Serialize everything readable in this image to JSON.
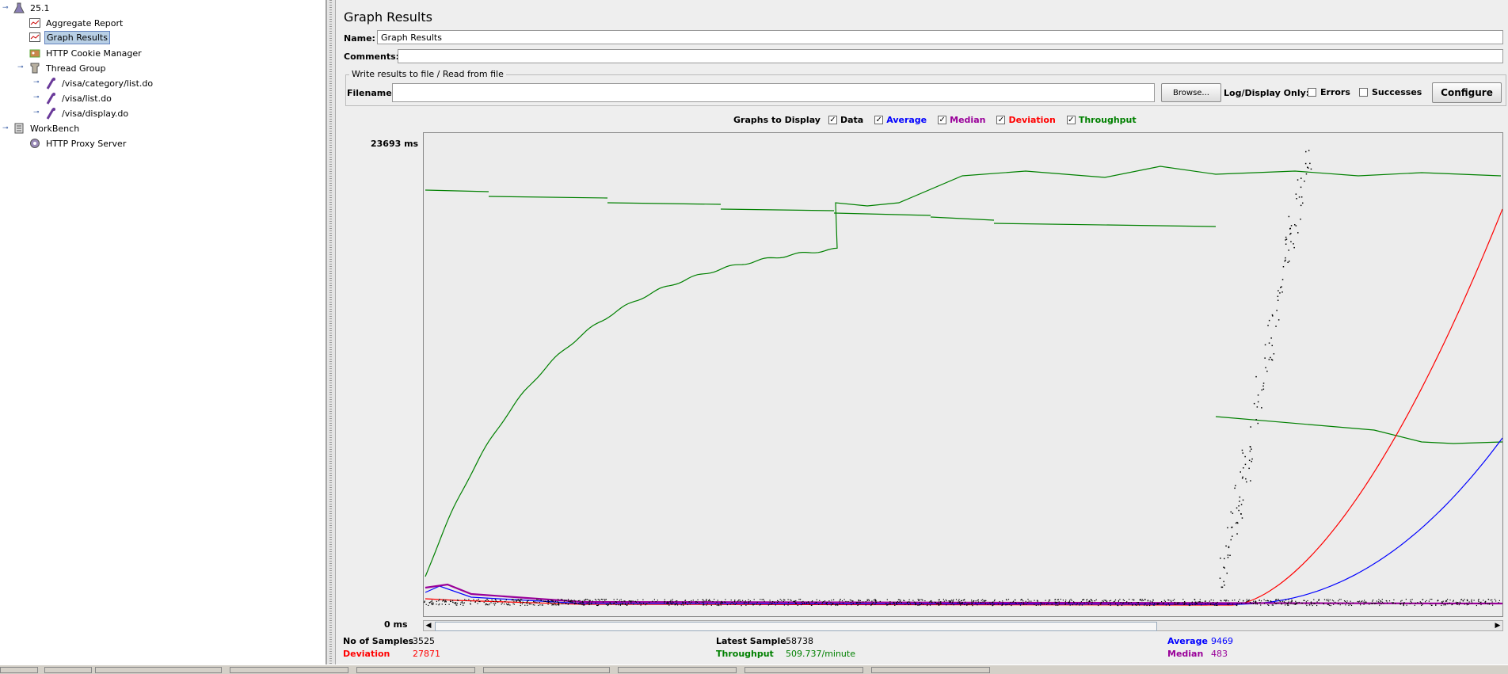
{
  "tree": {
    "items": [
      {
        "label": "25.1",
        "icon": "test-plan-icon"
      },
      {
        "label": "Aggregate Report",
        "icon": "report-icon"
      },
      {
        "label": "Graph Results",
        "icon": "graph-icon"
      },
      {
        "label": "HTTP Cookie Manager",
        "icon": "cookie-manager-icon"
      },
      {
        "label": "Thread Group",
        "icon": "thread-group-icon"
      },
      {
        "label": "/visa/category/list.do",
        "icon": "sampler-icon"
      },
      {
        "label": "/visa/list.do",
        "icon": "sampler-icon"
      },
      {
        "label": "/visa/display.do",
        "icon": "sampler-icon"
      },
      {
        "label": "WorkBench",
        "icon": "workbench-icon"
      },
      {
        "label": "HTTP Proxy Server",
        "icon": "proxy-icon"
      }
    ]
  },
  "panel": {
    "title": "Graph Results",
    "name_label": "Name:",
    "name_value": "Graph Results",
    "comments_label": "Comments:",
    "comments_value": "",
    "file_group_title": "Write results to file / Read from file",
    "filename_label": "Filename",
    "filename_value": "",
    "browse_label": "Browse...",
    "log_display_label": "Log/Display Only:",
    "errors_label": "Errors",
    "successes_label": "Successes",
    "configure_label": "Configure"
  },
  "graphs": {
    "label": "Graphs to Display",
    "items": [
      {
        "label": "Data",
        "checked": true,
        "color": "#000000"
      },
      {
        "label": "Average",
        "checked": true,
        "color": "#0000ff"
      },
      {
        "label": "Median",
        "checked": true,
        "color": "#990099"
      },
      {
        "label": "Deviation",
        "checked": true,
        "color": "#ff0000"
      },
      {
        "label": "Throughput",
        "checked": true,
        "color": "#008000"
      }
    ]
  },
  "chart_data": {
    "type": "line",
    "y_axis_max_label": "23693  ms",
    "y_axis_min_label": "0  ms",
    "ylim": [
      0,
      23693
    ],
    "series": [
      {
        "name": "Data",
        "color": "#000000"
      },
      {
        "name": "Average",
        "color": "#0000ff"
      },
      {
        "name": "Median",
        "color": "#990099"
      },
      {
        "name": "Deviation",
        "color": "#ff0000"
      },
      {
        "name": "Throughput",
        "color": "#008000"
      }
    ]
  },
  "stats": {
    "samples_label": "No of Samples",
    "samples_value": "3525",
    "deviation_label": "Deviation",
    "deviation_value": "27871",
    "latest_label": "Latest Sample",
    "latest_value": "58738",
    "throughput_label": "Throughput",
    "throughput_value": "509.737/minute",
    "average_label": "Average",
    "average_value": "9469",
    "median_label": "Median",
    "median_value": "483"
  }
}
